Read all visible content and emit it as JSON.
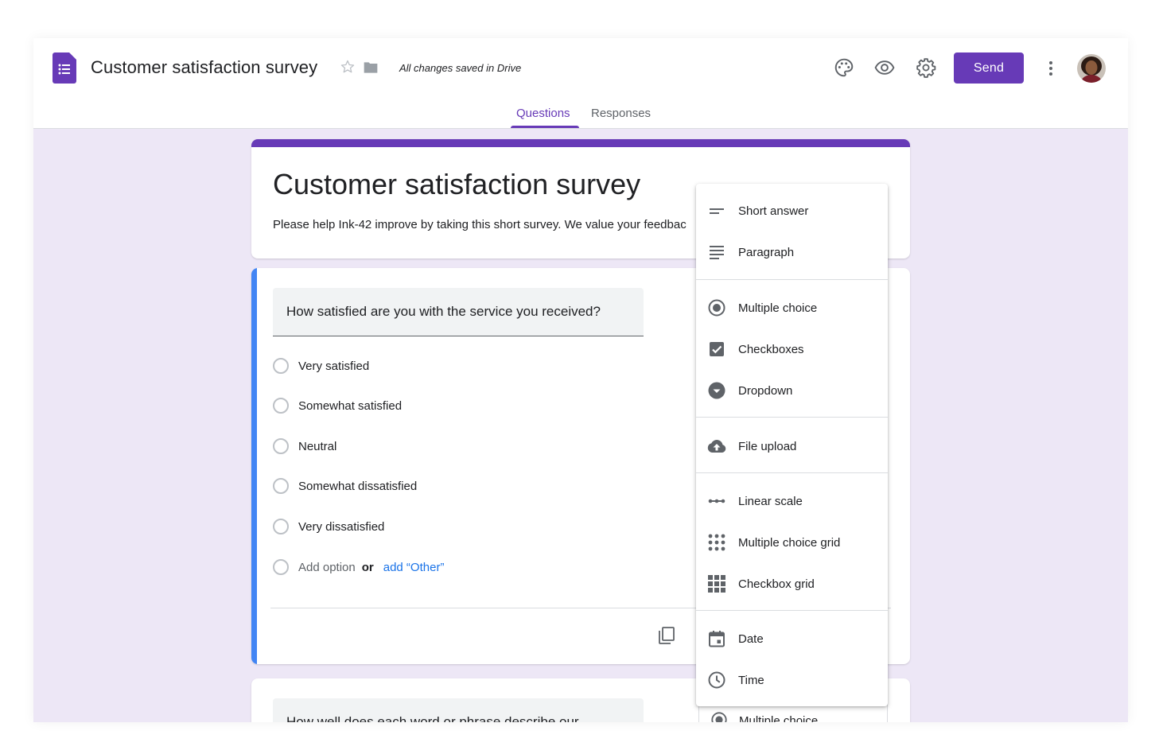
{
  "header": {
    "doc_title": "Customer satisfaction survey",
    "save_status": "All changes saved in Drive",
    "send_label": "Send",
    "colors": {
      "accent": "#673ab7",
      "background": "#ede7f6",
      "question_accent": "#4285f4",
      "link": "#1a73e8"
    }
  },
  "tabs": [
    {
      "label": "Questions",
      "active": true
    },
    {
      "label": "Responses",
      "active": false
    }
  ],
  "form": {
    "title": "Customer satisfaction survey",
    "description": "Please help Ink-42 improve by taking this short survey. We value your feedbac"
  },
  "question1": {
    "text": "How satisfied are you with the service you received?",
    "options": [
      "Very satisfied",
      "Somewhat satisfied",
      "Neutral",
      "Somewhat dissatisfied",
      "Very dissatisfied"
    ],
    "add_option": "Add option",
    "or": "or",
    "add_other": "add “Other”"
  },
  "question2": {
    "text": "How well does each word or phrase describe our",
    "type_label": "Multiple choice"
  },
  "type_menu": {
    "items": [
      {
        "label": "Short answer",
        "icon": "short-answer-icon"
      },
      {
        "label": "Paragraph",
        "icon": "paragraph-icon"
      },
      {
        "label": "Multiple choice",
        "icon": "radio-icon"
      },
      {
        "label": "Checkboxes",
        "icon": "checkbox-icon"
      },
      {
        "label": "Dropdown",
        "icon": "dropdown-icon"
      },
      {
        "label": "File upload",
        "icon": "cloud-upload-icon"
      },
      {
        "label": "Linear scale",
        "icon": "linear-scale-icon"
      },
      {
        "label": "Multiple choice grid",
        "icon": "dot-grid-icon"
      },
      {
        "label": "Checkbox grid",
        "icon": "square-grid-icon"
      },
      {
        "label": "Date",
        "icon": "calendar-icon"
      },
      {
        "label": "Time",
        "icon": "clock-icon"
      }
    ]
  }
}
